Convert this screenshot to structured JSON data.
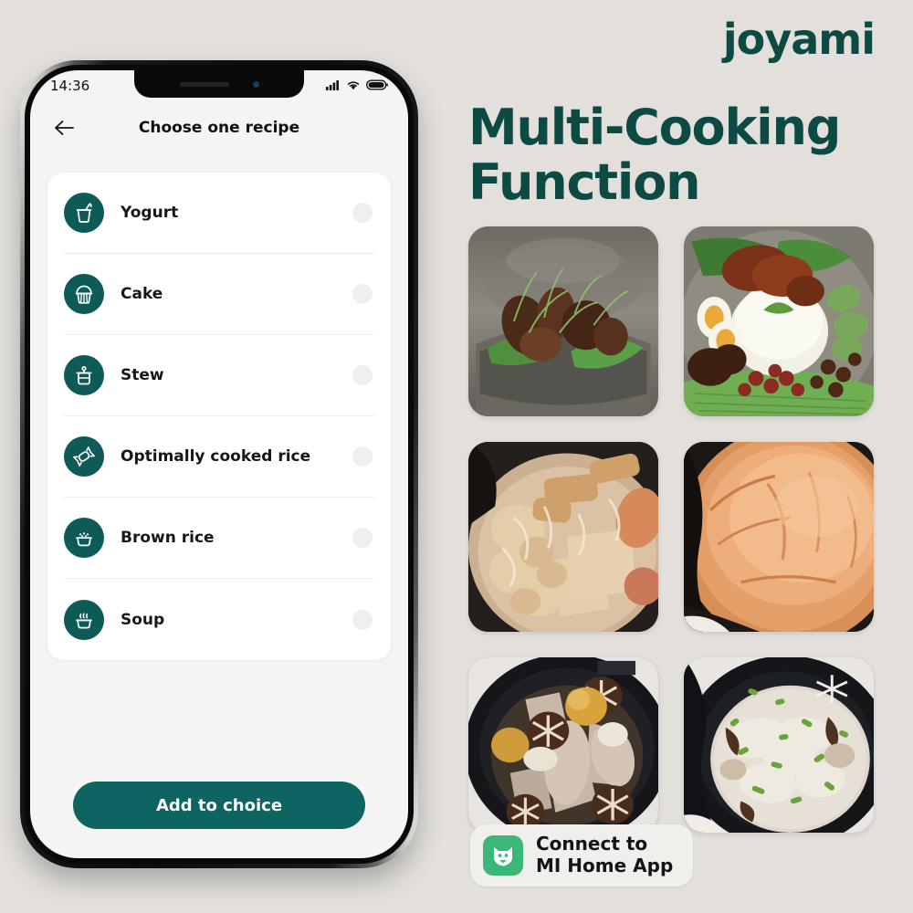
{
  "brand": {
    "name": "joyami"
  },
  "headline": {
    "text": "Multi-Cooking Function"
  },
  "mi_home": {
    "badge_text": "Connect to\nMI Home App",
    "logo_icon": "mi-home-cat-icon"
  },
  "phone": {
    "status_bar": {
      "time": "14:36",
      "icons": [
        "signal-icon",
        "wifi-icon",
        "battery-icon"
      ]
    },
    "app_bar": {
      "back_icon": "arrow-left-icon",
      "title": "Choose one recipe"
    },
    "recipes": [
      {
        "label": "Yogurt",
        "icon": "yogurt-cup-icon",
        "selected": false
      },
      {
        "label": "Cake",
        "icon": "cupcake-icon",
        "selected": false
      },
      {
        "label": "Stew",
        "icon": "stew-pot-icon",
        "selected": false
      },
      {
        "label": "Optimally cooked rice",
        "icon": "rice-grain-icon",
        "selected": false
      },
      {
        "label": "Brown rice",
        "icon": "rice-bowl-icon",
        "selected": false
      },
      {
        "label": "Soup",
        "icon": "soup-bowl-icon",
        "selected": false
      }
    ],
    "cta": {
      "label": "Add to choice"
    }
  },
  "gallery": [
    {
      "name": "fried-chicken-on-banana-leaf",
      "caption": "Fried chicken with herbs on banana leaf"
    },
    {
      "name": "nasi-lemak-plate",
      "caption": "Nasi lemak with rice, egg, peanuts and sambal"
    },
    {
      "name": "oden-hotpot",
      "caption": "Oden hotpot with tofu puffs and mushrooms"
    },
    {
      "name": "baked-sponge-cake",
      "caption": "Golden baked sponge cake in pot"
    },
    {
      "name": "pork-rib-mushroom-stew",
      "caption": "Pork ribs stewed with shiitake and chestnuts"
    },
    {
      "name": "congee-porridge",
      "caption": "Congee with scallions and mushrooms"
    }
  ],
  "colors": {
    "brand_green": "#0d4a43",
    "icon_teal": "#0e5a56",
    "cta_teal": "#0e6460",
    "background": "#e3e0dc",
    "mi_green": "#3bb878"
  }
}
